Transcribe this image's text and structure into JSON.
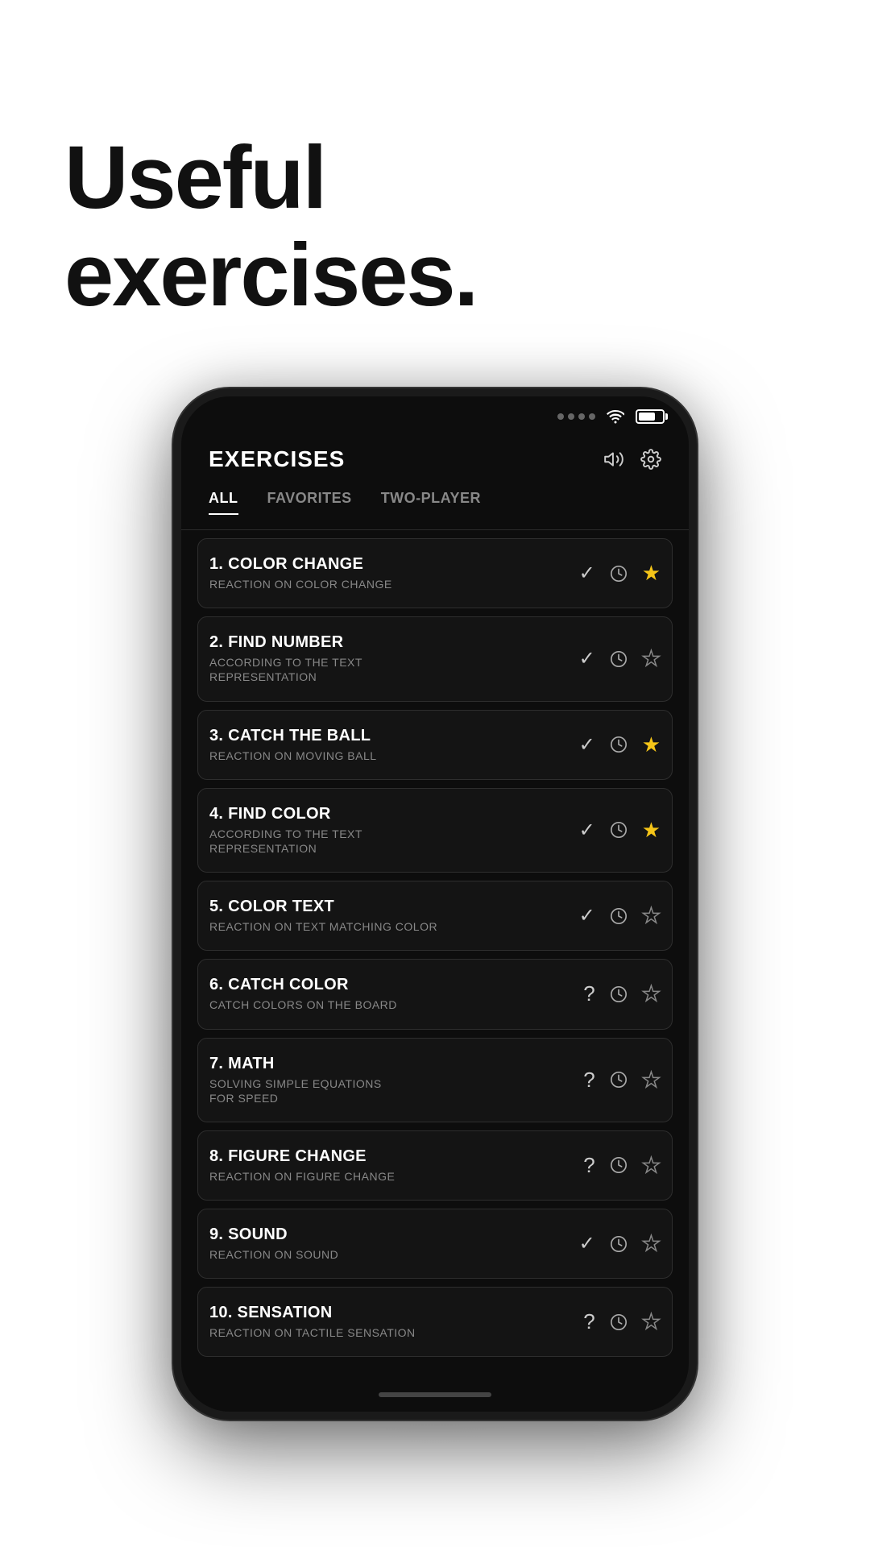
{
  "hero": {
    "title_line1": "Useful",
    "title_line2": "exercises."
  },
  "status_bar": {
    "dots": [
      1,
      2,
      3,
      4
    ],
    "wifi_label": "wifi",
    "battery_label": "battery"
  },
  "app": {
    "title": "EXERCISES",
    "sound_icon": "sound-icon",
    "settings_icon": "settings-icon"
  },
  "tabs": [
    {
      "label": "ALL",
      "active": true
    },
    {
      "label": "FAVORITES",
      "active": false
    },
    {
      "label": "TWO-PLAYER",
      "active": false
    }
  ],
  "exercises": [
    {
      "number": "1.",
      "name": "COLOR CHANGE",
      "description": "REACTION ON COLOR CHANGE",
      "status": "check",
      "starred": true
    },
    {
      "number": "2.",
      "name": "FIND NUMBER",
      "description": "ACCORDING TO THE TEXT REPRESENTATION",
      "status": "check",
      "starred": false
    },
    {
      "number": "3.",
      "name": "CATCH THE BALL",
      "description": "REACTION ON MOVING BALL",
      "status": "check",
      "starred": true
    },
    {
      "number": "4.",
      "name": "FIND COLOR",
      "description": "ACCORDING TO THE TEXT REPRESENTATION",
      "status": "check",
      "starred": true
    },
    {
      "number": "5.",
      "name": "COLOR TEXT",
      "description": "REACTION ON TEXT MATCHING COLOR",
      "status": "check",
      "starred": false
    },
    {
      "number": "6.",
      "name": "CATCH COLOR",
      "description": "CATCH COLORS ON THE BOARD",
      "status": "question",
      "starred": false
    },
    {
      "number": "7.",
      "name": "MATH",
      "description": "SOLVING SIMPLE EQUATIONS FOR SPEED",
      "status": "question",
      "starred": false
    },
    {
      "number": "8.",
      "name": "FIGURE CHANGE",
      "description": "REACTION ON FIGURE CHANGE",
      "status": "question",
      "starred": false
    },
    {
      "number": "9.",
      "name": "SOUND",
      "description": "REACTION ON SOUND",
      "status": "check",
      "starred": false
    },
    {
      "number": "10.",
      "name": "SENSATION",
      "description": "REACTION ON TACTILE SENSATION",
      "status": "question",
      "starred": false
    }
  ]
}
